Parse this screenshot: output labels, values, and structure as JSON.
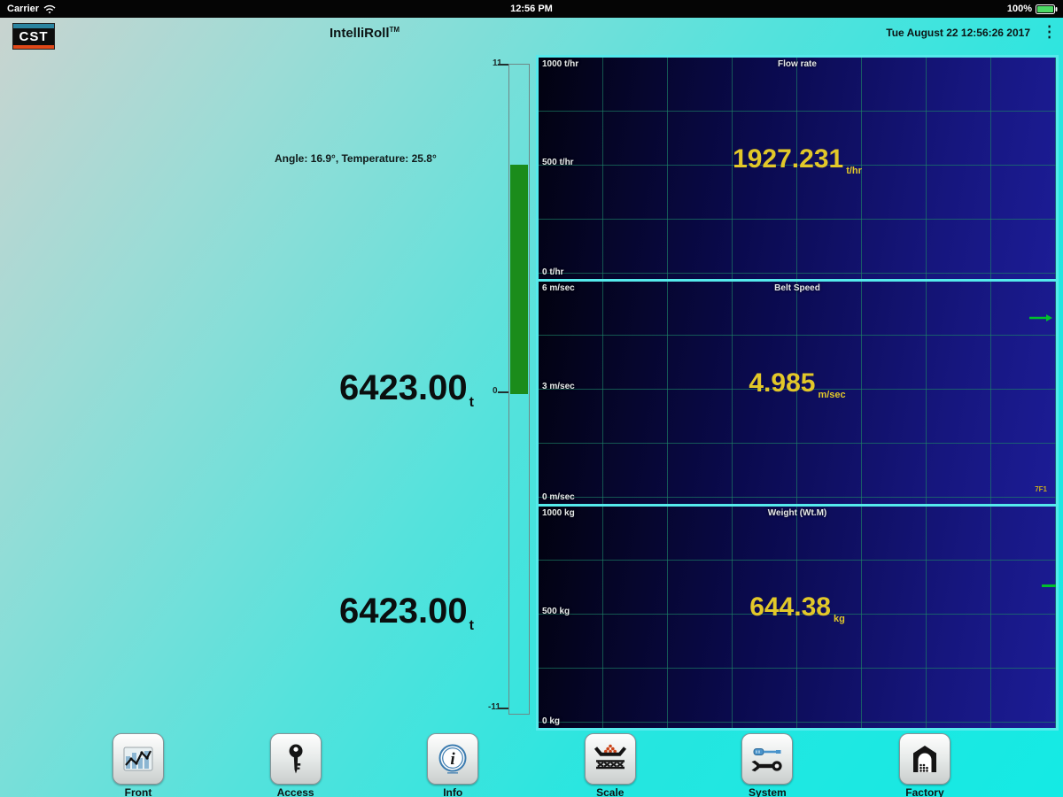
{
  "status_bar": {
    "carrier": "Carrier",
    "time": "12:56 PM",
    "battery_percent": "100%"
  },
  "header": {
    "logo_text": "CST",
    "app_title": "IntelliRoll",
    "trademark": "TM",
    "datetime": "Tue August 22 12:56:26 2017",
    "menu_icon": "⋮"
  },
  "left_panel": {
    "conditions": "Angle: 16.9°, Temperature: 25.8°",
    "total_top": {
      "value": "6423.00",
      "unit": "t"
    },
    "total_bottom": {
      "value": "6423.00",
      "unit": "t"
    },
    "gauge": {
      "top_label": "11",
      "zero_label": "0",
      "bottom_label": "-11"
    }
  },
  "charts": [
    {
      "type": "trend-panel",
      "title": "Flow rate",
      "y_top": "1000 t/hr",
      "y_mid": "500 t/hr",
      "y_bottom": "0 t/hr",
      "ylim": [
        0,
        1000
      ],
      "value": "1927.231",
      "unit": "t/hr",
      "grid": true,
      "series": []
    },
    {
      "type": "trend-panel",
      "title": "Belt Speed",
      "y_top": "6 m/sec",
      "y_mid": "3 m/sec",
      "y_bottom": "0 m/sec",
      "ylim": [
        0,
        6
      ],
      "value": "4.985",
      "unit": "m/sec",
      "corner_tag": "7F1",
      "grid": true,
      "series": []
    },
    {
      "type": "trend-panel",
      "title": "Weight (Wt.M)",
      "y_top": "1000 kg",
      "y_mid": "500 kg",
      "y_bottom": "0 kg",
      "ylim": [
        0,
        1000
      ],
      "value": "644.38",
      "unit": "kg",
      "grid": true,
      "series": []
    }
  ],
  "toolbar": {
    "buttons": [
      {
        "label": "Front"
      },
      {
        "label": "Access"
      },
      {
        "label": "Info"
      },
      {
        "label": "Scale"
      },
      {
        "label": "System"
      },
      {
        "label": "Factory"
      }
    ]
  },
  "colors": {
    "accent_cyan": "#2ce8e2",
    "chart_border_cyan": "#55eaec",
    "chart_bg_navy": "#10106a",
    "grid_teal": "#1c8266",
    "value_yellow": "#e2c829",
    "gauge_green": "#1b8c1b",
    "marker_green": "#00c02c",
    "logo_red": "#e04818",
    "logo_teal": "#2a84a0",
    "battery_green": "#4cd964"
  }
}
